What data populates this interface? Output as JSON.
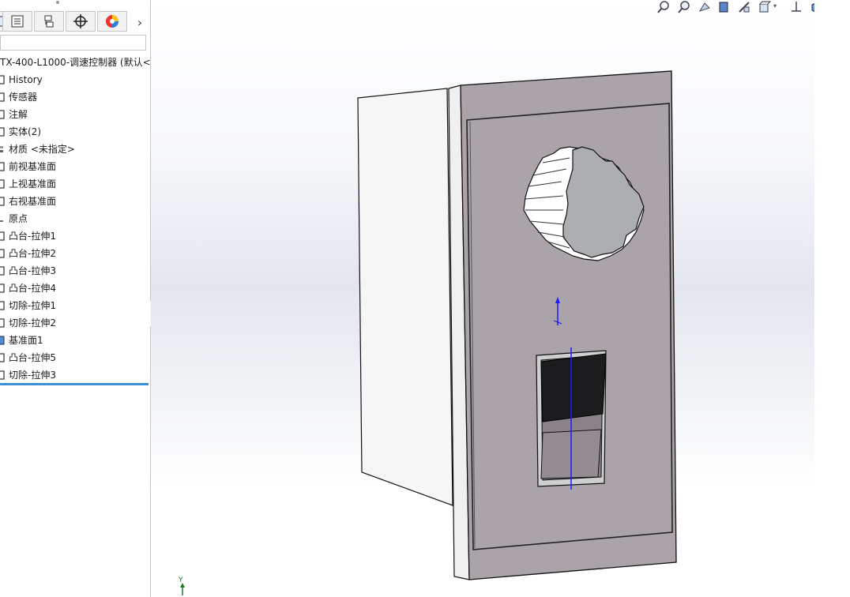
{
  "feature_tree": {
    "root_label": "TX-400-L1000-调速控制器 (默认<",
    "items": [
      {
        "label": "History",
        "icon": "history-icon"
      },
      {
        "label": "传感器",
        "icon": "sensor-icon"
      },
      {
        "label": "注解",
        "icon": "annotation-icon"
      },
      {
        "label": "实体(2)",
        "icon": "solid-bodies-icon"
      },
      {
        "label": "材质 <未指定>",
        "icon": "material-icon"
      },
      {
        "label": "前视基准面",
        "icon": "plane-icon"
      },
      {
        "label": "上视基准面",
        "icon": "plane-icon"
      },
      {
        "label": "右视基准面",
        "icon": "plane-icon"
      },
      {
        "label": "原点",
        "icon": "origin-icon"
      },
      {
        "label": "凸台-拉伸1",
        "icon": "boss-extrude-icon"
      },
      {
        "label": "凸台-拉伸2",
        "icon": "boss-extrude-icon"
      },
      {
        "label": "凸台-拉伸3",
        "icon": "boss-extrude-icon"
      },
      {
        "label": "凸台-拉伸4",
        "icon": "boss-extrude-icon"
      },
      {
        "label": "切除-拉伸1",
        "icon": "cut-extrude-icon"
      },
      {
        "label": "切除-拉伸2",
        "icon": "cut-extrude-icon"
      },
      {
        "label": "基准面1",
        "icon": "plane-icon"
      },
      {
        "label": "凸台-拉伸5",
        "icon": "boss-extrude-icon"
      },
      {
        "label": "切除-拉伸3",
        "icon": "cut-extrude-icon"
      }
    ]
  },
  "panel_tabs": [
    "feature-manager-icon",
    "property-manager-icon",
    "configuration-manager-icon",
    "dimxpert-icon",
    "display-manager-icon"
  ],
  "triad": {
    "y_label": "Y"
  },
  "colors": {
    "accent": "#3a8fd6",
    "faceplate": "#aaa2a9",
    "housing": "#f4f4f4",
    "switch_dark": "#1c1c1e",
    "axis_blue": "#1a1aff"
  }
}
